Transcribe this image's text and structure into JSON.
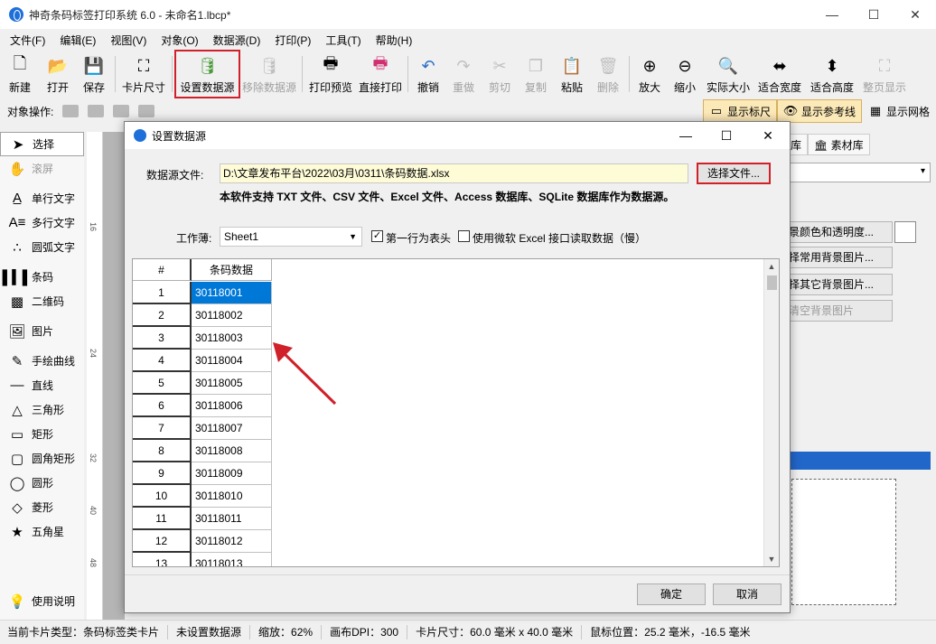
{
  "window": {
    "title": "神奇条码标签打印系统 6.0 - 未命名1.lbcp*",
    "controls": [
      "—",
      "☐",
      "✕"
    ]
  },
  "menu": [
    "文件(F)",
    "编辑(E)",
    "视图(V)",
    "对象(O)",
    "数据源(D)",
    "打印(P)",
    "工具(T)",
    "帮助(H)"
  ],
  "toolbar": {
    "new": "新建",
    "open": "打开",
    "save": "保存",
    "card_size": "卡片尺寸",
    "set_datasource": "设置数据源",
    "remove_datasource": "移除数据源",
    "print_preview": "打印预览",
    "direct_print": "直接打印",
    "undo": "撤销",
    "redo": "重做",
    "cut": "剪切",
    "copy": "复制",
    "paste": "粘贴",
    "delete": "删除",
    "zoom_in": "放大",
    "zoom_out": "缩小",
    "actual_size": "实际大小",
    "fit_width": "适合宽度",
    "fit_height": "适合高度",
    "full_page": "整页显示"
  },
  "ops_bar": {
    "label": "对象操作:",
    "show_ruler": "显示标尺",
    "show_guides": "显示参考线",
    "show_grid": "显示网格"
  },
  "tools": {
    "select": "选择",
    "scroll": "滚屏",
    "single_text": "单行文字",
    "multi_text": "多行文字",
    "arc_text": "圆弧文字",
    "barcode": "条码",
    "qrcode": "二维码",
    "image": "图片",
    "freehand": "手绘曲线",
    "line": "直线",
    "triangle": "三角形",
    "rectangle": "矩形",
    "round_rect": "圆角矩形",
    "circle": "圆形",
    "diamond": "菱形",
    "star": "五角星",
    "help": "使用说明"
  },
  "ruler_marks": [
    "16",
    "24",
    "32",
    "40",
    "48"
  ],
  "right_panel": {
    "tabs": [
      "库",
      "素材库"
    ],
    "buttons": [
      "景颜色和透明度...",
      "择常用背景图片...",
      "择其它背景图片...",
      "清空背景图片"
    ]
  },
  "status": {
    "card_type": "当前卡片类型：条码标签类卡片",
    "datasource": "未设置数据源",
    "zoom": "缩放：62%",
    "dpi": "画布DPI：300",
    "card_size": "卡片尺寸：60.0 毫米 x 40.0 毫米",
    "mouse_pos": "鼠标位置：25.2 毫米，-16.5 毫米"
  },
  "dialog": {
    "title": "设置数据源",
    "file_label": "数据源文件:",
    "file_path": "D:\\文章发布平台\\2022\\03月\\0311\\条码数据.xlsx",
    "choose_button": "选择文件...",
    "support_note": "本软件支持 TXT 文件、CSV 文件、Excel 文件、Access 数据库、SQLite 数据库作为数据源。",
    "workbook_label": "工作薄:",
    "sheet": "Sheet1",
    "first_row_header": "第一行为表头",
    "first_row_checked": "✓",
    "use_ms_excel": "使用微软 Excel 接口读取数据（慢）",
    "ok": "确定",
    "cancel": "取消",
    "grid": {
      "headers": [
        "#",
        "条码数据"
      ],
      "rows": [
        [
          "1",
          "30118001"
        ],
        [
          "2",
          "30118002"
        ],
        [
          "3",
          "30118003"
        ],
        [
          "4",
          "30118004"
        ],
        [
          "5",
          "30118005"
        ],
        [
          "6",
          "30118006"
        ],
        [
          "7",
          "30118007"
        ],
        [
          "8",
          "30118008"
        ],
        [
          "9",
          "30118009"
        ],
        [
          "10",
          "30118010"
        ],
        [
          "11",
          "30118011"
        ],
        [
          "12",
          "30118012"
        ],
        [
          "13",
          "30118013"
        ]
      ]
    }
  },
  "colors": {
    "highlight_red": "#d0202a",
    "selection_blue": "#0078d7",
    "path_bg": "#fefbd7"
  }
}
